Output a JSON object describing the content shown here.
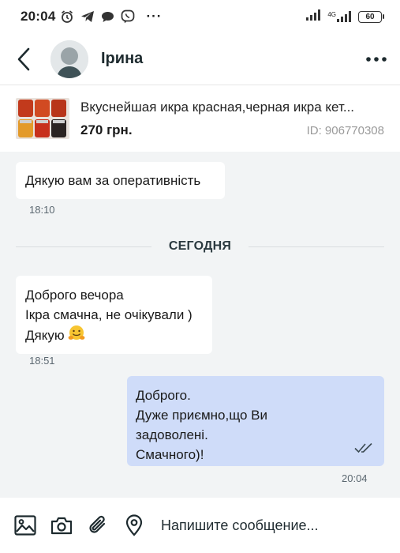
{
  "status_bar": {
    "time": "20:04",
    "network_label": "4G",
    "battery": "60",
    "icons": [
      "alarm-icon",
      "telegram-icon",
      "chat-bubble-icon",
      "viber-icon",
      "more-notifications-icon",
      "signal-icon",
      "signal-4g-icon",
      "battery-icon"
    ]
  },
  "header": {
    "contact_name": "Ірина"
  },
  "product": {
    "title": "Вкуснейшая икра красная,черная икра кет...",
    "price": "270 грн.",
    "id_text": "ID: 906770308"
  },
  "messages": [
    {
      "direction": "in",
      "text": "Дякую вам за оперативність",
      "time": "18:10"
    },
    {
      "direction": "in",
      "lines": [
        "Доброго вечора",
        "Ікра смачна, не очікували )",
        "Дякую"
      ],
      "emoji": "hugging-face-emoji",
      "time": "18:51"
    },
    {
      "direction": "out",
      "lines": [
        "Доброго.",
        "Дуже приємно,що Ви",
        "задоволені.",
        "Смачного)!"
      ],
      "time": "20:04",
      "status_icon": "double-check-icon"
    }
  ],
  "date_divider": "СЕГОДНЯ",
  "input": {
    "placeholder": "Напишите сообщение..."
  },
  "colors": {
    "incoming_bubble": "#ffffff",
    "outgoing_bubble": "#cfdcf9",
    "chat_background": "#f2f4f5",
    "icon_dark": "#1d2a2e"
  }
}
